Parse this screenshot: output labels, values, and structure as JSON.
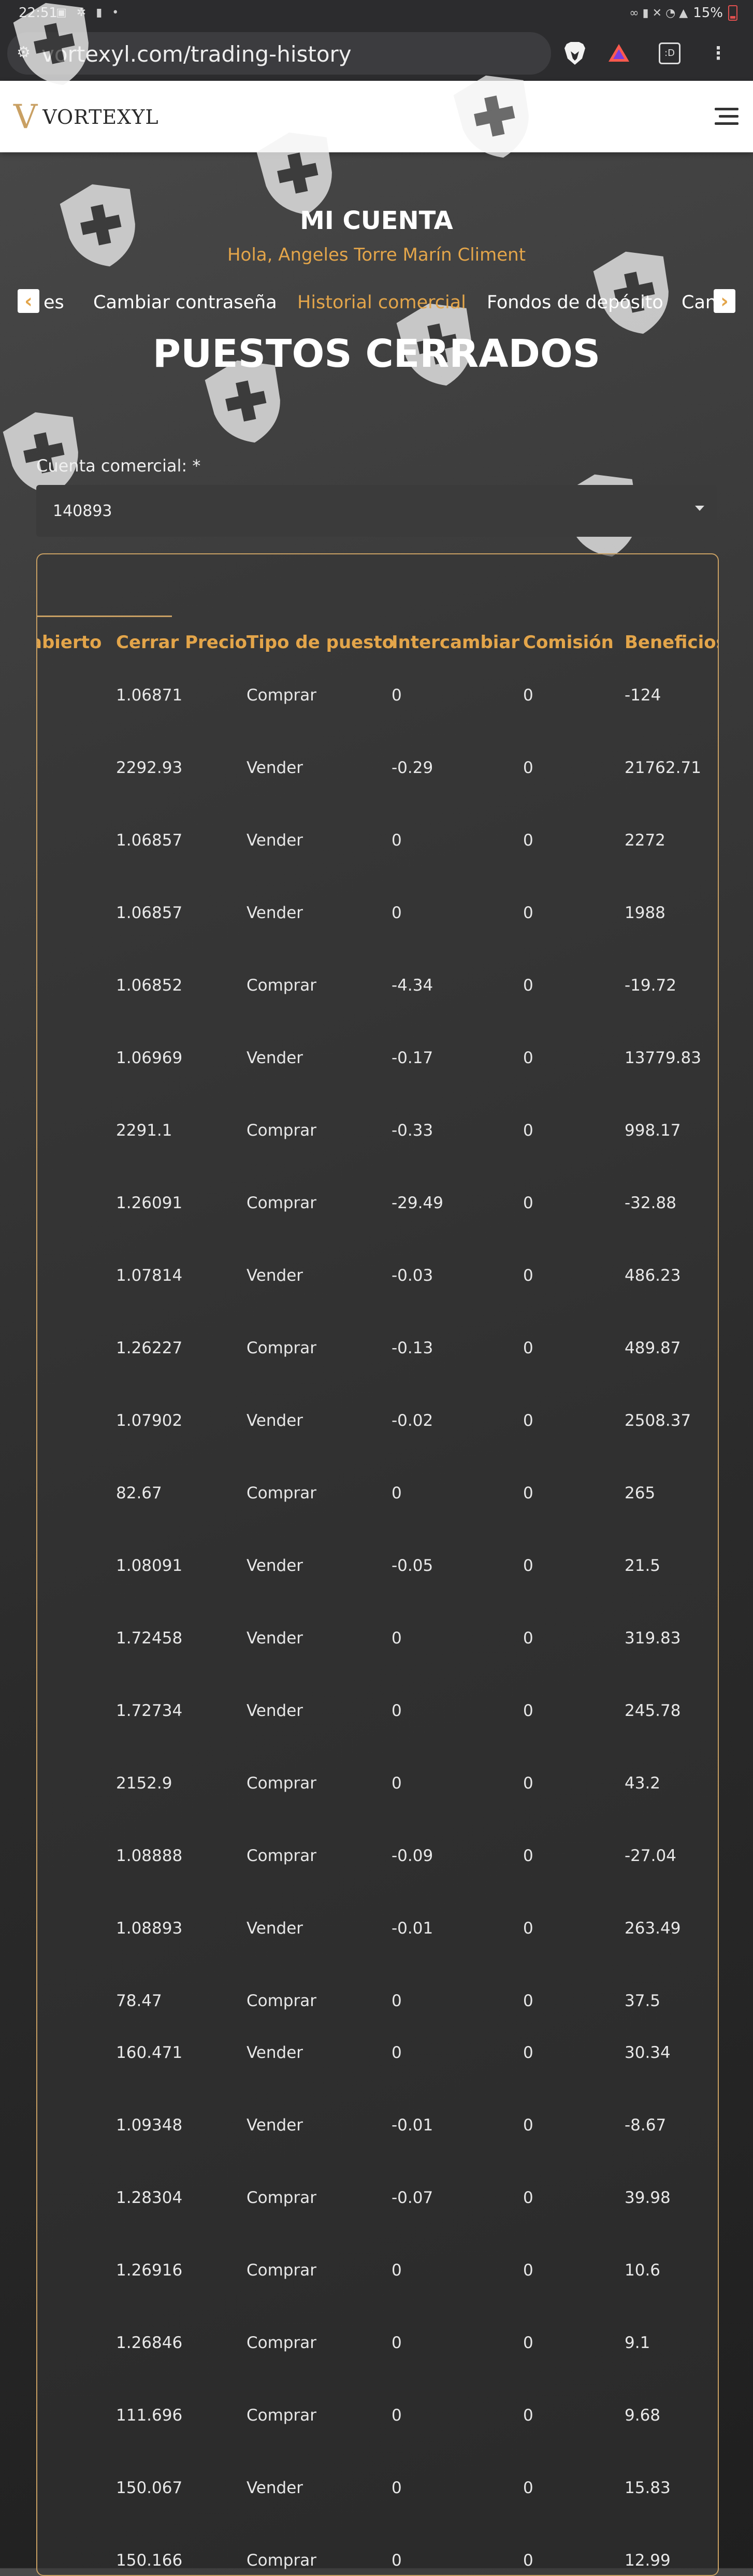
{
  "status_bar": {
    "time": "22:51",
    "battery": "15%"
  },
  "browser": {
    "url": "vortexyl.com/trading-history",
    "tab_count": ":D"
  },
  "site": {
    "brand": "VORTEXYL",
    "logo_mark": "V"
  },
  "account": {
    "title": "MI CUENTA",
    "greeting": "Hola, Angeles Torre Marín Climent"
  },
  "nav": {
    "items": [
      "es",
      "Cambiar contraseña",
      "Historial comercial",
      "Fondos de depósito",
      "Can"
    ],
    "active_index": 2
  },
  "page": {
    "heading": "PUESTOS CERRADOS",
    "account_label": "Cuenta comercial: *",
    "account_value": "140893"
  },
  "table": {
    "headers": [
      "abierto",
      "Cerrar Precio",
      "Tipo de puesto",
      "Intercambiar",
      "Comisión",
      "Beneficios"
    ],
    "rows": [
      [
        "1.06871",
        "Comprar",
        "0",
        "0",
        "-124"
      ],
      [
        "2292.93",
        "Vender",
        "-0.29",
        "0",
        "21762.71"
      ],
      [
        "1.06857",
        "Vender",
        "0",
        "0",
        "2272"
      ],
      [
        "1.06857",
        "Vender",
        "0",
        "0",
        "1988"
      ],
      [
        "1.06852",
        "Comprar",
        "-4.34",
        "0",
        "-19.72"
      ],
      [
        "1.06969",
        "Vender",
        "-0.17",
        "0",
        "13779.83"
      ],
      [
        "2291.1",
        "Comprar",
        "-0.33",
        "0",
        "998.17"
      ],
      [
        "1.26091",
        "Comprar",
        "-29.49",
        "0",
        "-32.88"
      ],
      [
        "1.07814",
        "Vender",
        "-0.03",
        "0",
        "486.23"
      ],
      [
        "1.26227",
        "Comprar",
        "-0.13",
        "0",
        "489.87"
      ],
      [
        "1.07902",
        "Vender",
        "-0.02",
        "0",
        "2508.37"
      ],
      [
        "82.67",
        "Comprar",
        "0",
        "0",
        "265"
      ],
      [
        "1.08091",
        "Vender",
        "-0.05",
        "0",
        "21.5"
      ],
      [
        "1.72458",
        "Vender",
        "0",
        "0",
        "319.83"
      ],
      [
        "1.72734",
        "Vender",
        "0",
        "0",
        "245.78"
      ],
      [
        "2152.9",
        "Comprar",
        "0",
        "0",
        "43.2"
      ],
      [
        "1.08888",
        "Comprar",
        "-0.09",
        "0",
        "-27.04"
      ],
      [
        "1.08893",
        "Vender",
        "-0.01",
        "0",
        "263.49"
      ],
      [
        "78.47",
        "Comprar",
        "0",
        "0",
        "37.5"
      ],
      [
        "160.471",
        "Vender",
        "0",
        "0",
        "30.34"
      ],
      [
        "1.09348",
        "Vender",
        "-0.01",
        "0",
        "-8.67"
      ],
      [
        "1.28304",
        "Comprar",
        "-0.07",
        "0",
        "39.98"
      ],
      [
        "1.26916",
        "Comprar",
        "0",
        "0",
        "10.6"
      ],
      [
        "1.26846",
        "Comprar",
        "0",
        "0",
        "9.1"
      ],
      [
        "111.696",
        "Comprar",
        "0",
        "0",
        "9.68"
      ],
      [
        "150.067",
        "Vender",
        "0",
        "0",
        "15.83"
      ],
      [
        "150.166",
        "Comprar",
        "0",
        "0",
        "12.99"
      ]
    ]
  },
  "colors": {
    "accent": "#e3a54a",
    "gold": "#c9a063"
  },
  "icons": [
    "tune-icon",
    "brave-icon",
    "rewards-icon",
    "tabs-icon",
    "kebab-menu-icon",
    "hamburger-icon",
    "chevron-left-icon",
    "chevron-right-icon",
    "caret-down-icon",
    "shield-watermark-icon"
  ]
}
